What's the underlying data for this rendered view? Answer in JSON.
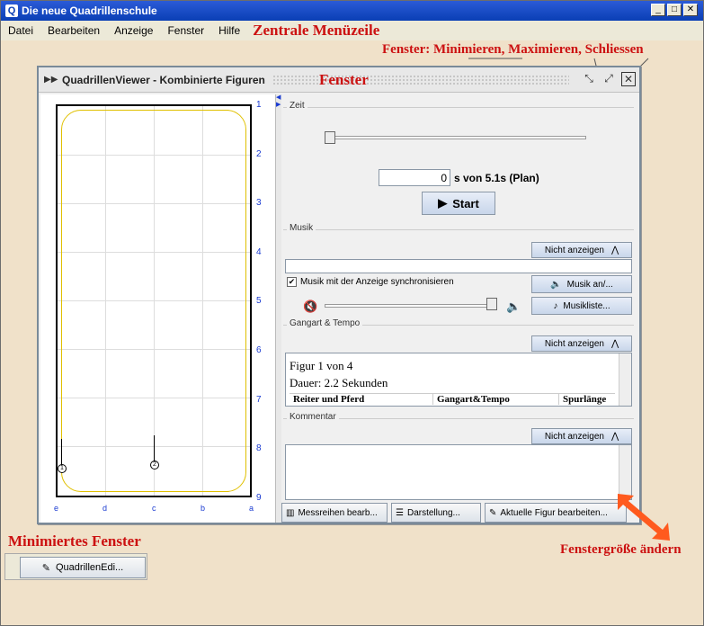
{
  "app": {
    "title": "Die neue Quadrillenschule",
    "icon": "Q"
  },
  "menu": [
    "Datei",
    "Bearbeiten",
    "Anzeige",
    "Fenster",
    "Hilfe"
  ],
  "annotations": {
    "menubar": "Zentrale Menüzeile",
    "window_controls": "Fenster: Minimieren,  Maximieren, Schliessen",
    "window": "Fenster",
    "minimized": "Minimiertes Fenster",
    "resize": "Fenstergröße ändern"
  },
  "viewer": {
    "title": "QuadrillenViewer - Kombinierte Figuren",
    "row_numbers": [
      "1",
      "2",
      "3",
      "4",
      "5",
      "6",
      "7",
      "8",
      "9"
    ],
    "col_letters": [
      "e",
      "d",
      "c",
      "b",
      "a"
    ]
  },
  "zeit": {
    "label": "Zeit",
    "value": "0",
    "value_suffix": "s von 5.1s (Plan)",
    "start_label": "Start",
    "slider_fraction": 0.0
  },
  "musik": {
    "label": "Musik",
    "hide_label": "Nicht anzeigen",
    "sync_label": "Musik mit der Anzeige synchronisieren",
    "sync_checked": true,
    "toggle_label": "Musik an/...",
    "list_label": "Musikliste...",
    "volume_fraction": 0.9
  },
  "gangart": {
    "label": "Gangart & Tempo",
    "hide_label": "Nicht anzeigen",
    "line1": "Figur 1 von 4",
    "line2": "Dauer: 2.2 Sekunden",
    "columns": [
      "Reiter und Pferd",
      "Gangart&Tempo",
      "Spurlänge"
    ]
  },
  "kommentar": {
    "label": "Kommentar",
    "hide_label": "Nicht anzeigen"
  },
  "bottom": {
    "messreihen": "Messreihen bearb...",
    "darstellung": "Darstellung...",
    "aktuelle": "Aktuelle Figur bearbeiten..."
  },
  "minimized_window": {
    "label": "QuadrillenEdi..."
  },
  "colors": {
    "annotation": "#cc1111",
    "title_blue": "#0a3fb5",
    "field_blue": "#1a3bd1"
  }
}
